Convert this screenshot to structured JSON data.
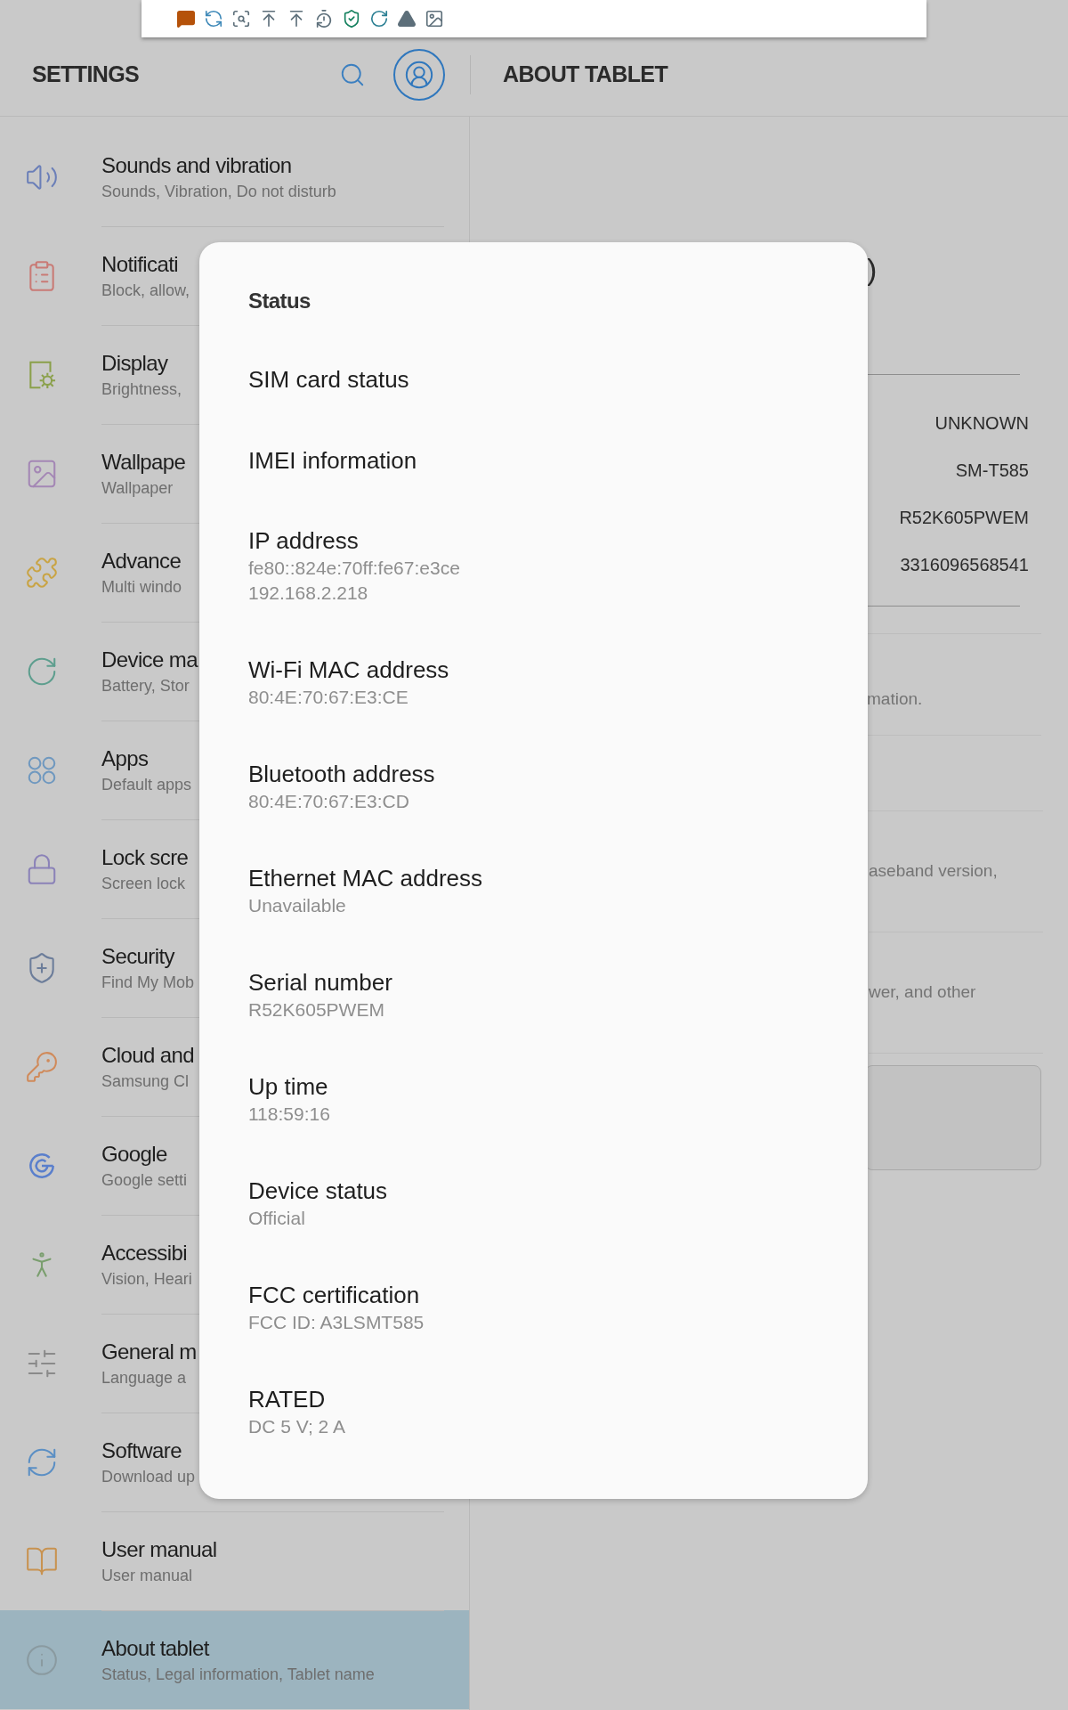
{
  "header": {
    "title": "SETTINGS",
    "detail_title": "ABOUT TABLET"
  },
  "settings": [
    {
      "title": "Sounds and vibration",
      "subtitle": "Sounds, Vibration, Do not disturb",
      "selected": false
    },
    {
      "title": "Notificati",
      "subtitle": "Block, allow,",
      "selected": false
    },
    {
      "title": "Display",
      "subtitle": "Brightness,",
      "selected": false
    },
    {
      "title": "Wallpape",
      "subtitle": "Wallpaper",
      "selected": false
    },
    {
      "title": "Advance",
      "subtitle": "Multi windo",
      "selected": false
    },
    {
      "title": "Device ma",
      "subtitle": "Battery, Stor",
      "selected": false
    },
    {
      "title": "Apps",
      "subtitle": "Default apps",
      "selected": false
    },
    {
      "title": "Lock scre",
      "subtitle": "Screen lock",
      "selected": false
    },
    {
      "title": "Security",
      "subtitle": "Find My Mob",
      "selected": false
    },
    {
      "title": "Cloud and",
      "subtitle": "Samsung Cl",
      "selected": false
    },
    {
      "title": "Google",
      "subtitle": "Google setti",
      "selected": false
    },
    {
      "title": "Accessibi",
      "subtitle": "Vision, Heari",
      "selected": false
    },
    {
      "title": "General m",
      "subtitle": "Language a",
      "selected": false
    },
    {
      "title": "Software",
      "subtitle": "Download up",
      "selected": false
    },
    {
      "title": "User manual",
      "subtitle": "User manual",
      "selected": false
    },
    {
      "title": "About tablet",
      "subtitle": "Status, Legal information, Tablet name",
      "selected": true
    }
  ],
  "detail": {
    "heading_fragment": ")",
    "values": [
      "UNKNOWN",
      "SM-T585",
      "R52K605PWEM",
      "3316096568541"
    ],
    "fragments": [
      "mation.",
      "aseband version,",
      "wer, and other"
    ]
  },
  "dialog": {
    "title": "Status",
    "items": [
      {
        "label": "SIM card status"
      },
      {
        "label": "IMEI information"
      },
      {
        "label": "IP address",
        "details": [
          "fe80::824e:70ff:fe67:e3ce",
          "192.168.2.218"
        ]
      },
      {
        "label": "Wi-Fi MAC address",
        "details": [
          "80:4E:70:67:E3:CE"
        ]
      },
      {
        "label": "Bluetooth address",
        "details": [
          "80:4E:70:67:E3:CD"
        ]
      },
      {
        "label": "Ethernet MAC address",
        "details": [
          "Unavailable"
        ]
      },
      {
        "label": "Serial number",
        "details": [
          "R52K605PWEM"
        ]
      },
      {
        "label": "Up time",
        "details": [
          "118:59:16"
        ]
      },
      {
        "label": "Device status",
        "details": [
          "Official"
        ]
      },
      {
        "label": "FCC certification",
        "details": [
          "FCC ID: A3LSMT585"
        ]
      },
      {
        "label": "RATED",
        "details": [
          "DC 5 V; 2 A"
        ]
      }
    ]
  }
}
